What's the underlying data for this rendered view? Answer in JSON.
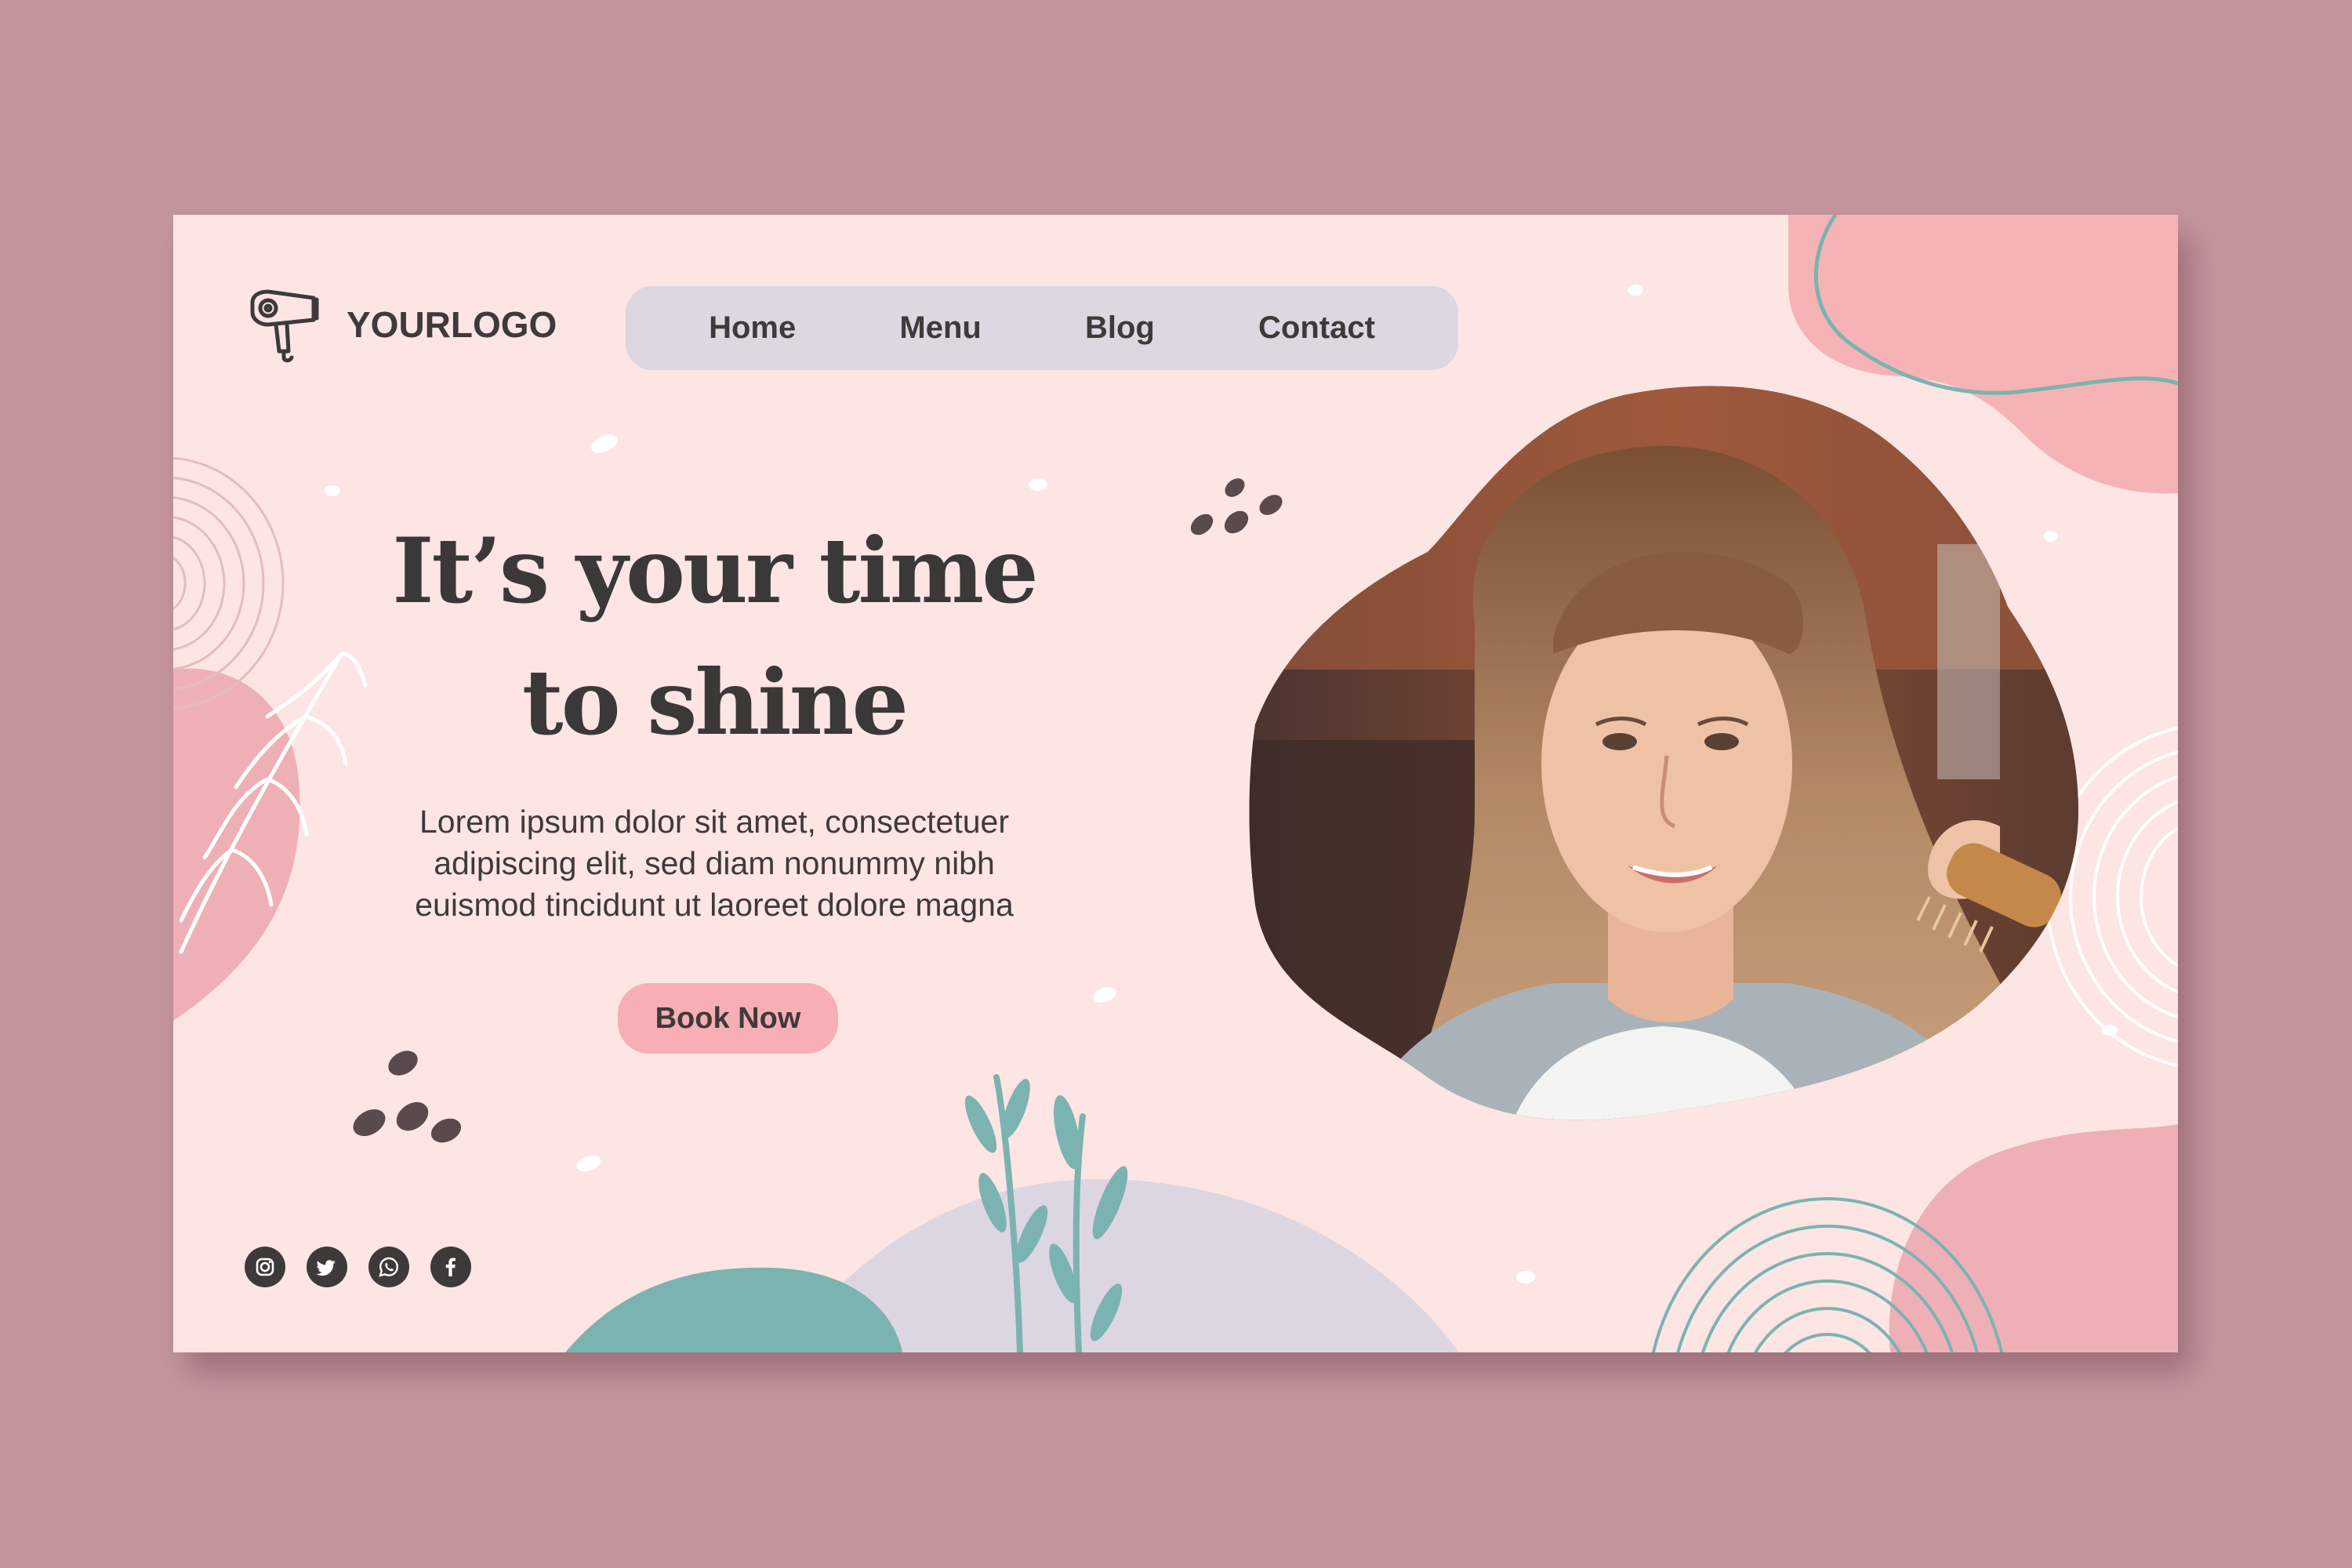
{
  "brand": {
    "logo_text": "YOURLOGO",
    "logo_icon": "hair-dryer-icon"
  },
  "nav": {
    "items": [
      {
        "label": "Home"
      },
      {
        "label": "Menu"
      },
      {
        "label": "Blog"
      },
      {
        "label": "Contact"
      }
    ]
  },
  "hero": {
    "headline_line1": "It’s your time",
    "headline_line2": "to shine",
    "body_line1": "Lorem ipsum dolor sit amet, consectetuer",
    "body_line2": "adipiscing elit, sed diam nonummy nibh",
    "body_line3": "euismod tincidunt ut laoreet dolore magna",
    "cta_label": "Book Now"
  },
  "social": {
    "icons": [
      "instagram-icon",
      "twitter-icon",
      "whatsapp-icon",
      "facebook-icon"
    ]
  },
  "colors": {
    "page_background": "#c4959d",
    "card_background": "#fde5e4",
    "nav_background": "#dcd7e1",
    "cta_background": "#f7aeb4",
    "accent_pink": "#f6b3b6",
    "accent_teal": "#7bb3b0",
    "accent_lavender": "#dcd6e2",
    "text_dark": "#3e3a3a"
  }
}
